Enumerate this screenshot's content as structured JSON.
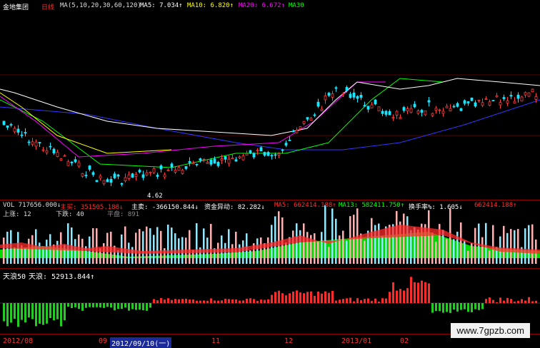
{
  "header": {
    "stock_name": "金地集团",
    "period": "日线",
    "ma_label": "MA(5,10,20,30,60,120)",
    "ma5": "MA5: 7.034↑",
    "ma10": "MA10: 6.820↑",
    "ma20": "MA20: 6.672↑",
    "ma30": "MA30"
  },
  "price_panel": {
    "low_marker": "4.62"
  },
  "vol_panel": {
    "vol": "VOL 717656.000↓",
    "main_sell": "主买: 351505.188↓",
    "main_buy": "主卖: -366150.844↓",
    "capital_change": "资金异动: 82.282↓",
    "ma5": "MA5: 662414.188↑",
    "ma13": "MA13: 582411.750↑",
    "turnover": "换手率%: 1.605↓",
    "extra": "662414.188↑",
    "up": "上涨: 12",
    "down": "下跌: 40",
    "flat": "平盘: 891"
  },
  "wave_panel": {
    "label": "天浪50",
    "value": "天浪: 52913.844↑"
  },
  "footer": {
    "labels": [
      "2012/08",
      "09",
      "2012/09/10(一)",
      "11",
      "12",
      "2013/01",
      "02"
    ]
  },
  "watermark": "www.7gpzb.com",
  "colors": {
    "up": "#ff3b3b",
    "down": "#19e6ff",
    "ma5": "#ffffff",
    "ma10": "#ffff00",
    "ma20": "#ff00ff",
    "ma30": "#00ff00",
    "ma60": "#3535ff",
    "wave_up": "#ff2a2a",
    "wave_down": "#22cc22"
  },
  "chart_data": {
    "type": "line",
    "title": "金地集团 日线",
    "series": [
      {
        "name": "MA5",
        "value": 7.034
      },
      {
        "name": "MA10",
        "value": 6.82
      },
      {
        "name": "MA20",
        "value": 6.672
      }
    ],
    "price_low": 4.62,
    "volume": 717656.0,
    "turnover_pct": 1.605,
    "wave_value": 52913.844,
    "x_ticks": [
      "2012/08",
      "09",
      "2012/09/10(一)",
      "11",
      "12",
      "2013/01",
      "02"
    ]
  }
}
